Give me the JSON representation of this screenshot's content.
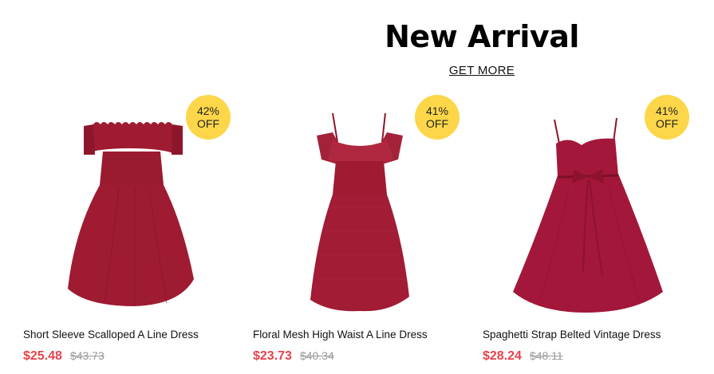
{
  "section": {
    "title": "New Arrival",
    "link": "GET MORE"
  },
  "products": [
    {
      "name": "Short Sleeve Scalloped A Line Dress",
      "price": "$25.48",
      "original_price": "$43.73",
      "discount_pct": "42%",
      "discount_off": "OFF",
      "color": "#9e1b32"
    },
    {
      "name": "Floral Mesh High Waist A Line Dress",
      "price": "$23.73",
      "original_price": "$40.34",
      "discount_pct": "41%",
      "discount_off": "OFF",
      "color": "#9e1b32"
    },
    {
      "name": "Spaghetti Strap Belted Vintage Dress",
      "price": "$28.24",
      "original_price": "$48.11",
      "discount_pct": "41%",
      "discount_off": "OFF",
      "color": "#a3173a"
    }
  ],
  "colors": {
    "badge": "#fdd649",
    "sale_price": "#e8424b",
    "original_price": "#999999"
  }
}
